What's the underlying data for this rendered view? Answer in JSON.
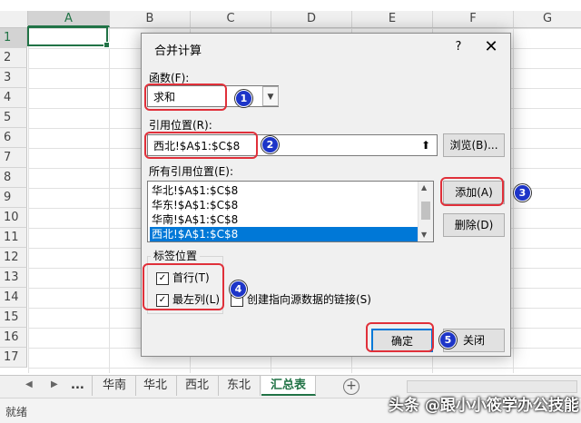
{
  "spreadsheet": {
    "columns": [
      "A",
      "B",
      "C",
      "D",
      "E",
      "F",
      "G"
    ],
    "rows": [
      "1",
      "2",
      "3",
      "4",
      "5",
      "6",
      "7",
      "8",
      "9",
      "10",
      "11",
      "12",
      "13",
      "14",
      "15",
      "16",
      "17"
    ],
    "sheet_tabs": [
      "...",
      "华南",
      "华北",
      "西北",
      "东北",
      "汇总表"
    ],
    "active_tab": "汇总表",
    "status_text": "就绪"
  },
  "dialog": {
    "title": "合并计算",
    "help_label": "?",
    "close_label": "✕",
    "function_label": "函数(F):",
    "function_value": "求和",
    "reference_label": "引用位置(R):",
    "reference_value": "西北!$A$1:$C$8",
    "browse_button": "浏览(B)...",
    "all_references_label": "所有引用位置(E):",
    "all_references": [
      "华北!$A$1:$C$8",
      "华东!$A$1:$C$8",
      "华南!$A$1:$C$8",
      "西北!$A$1:$C$8"
    ],
    "selected_reference_index": 3,
    "add_button": "添加(A)",
    "delete_button": "删除(D)",
    "label_position_group": "标签位置",
    "top_row_label": "首行(T)",
    "left_column_label": "最左列(L)",
    "create_links_label": "创建指向源数据的链接(S)",
    "ok_button": "确定",
    "close_button": "关闭"
  },
  "annotations": [
    "1",
    "2",
    "3",
    "4",
    "5"
  ],
  "watermark": "头条 @跟小小筱学办公技能",
  "colors": {
    "accent": "#217346",
    "selection": "#0078d7",
    "annotation_ring": "#e0303a",
    "badge": "#1d35c8"
  }
}
